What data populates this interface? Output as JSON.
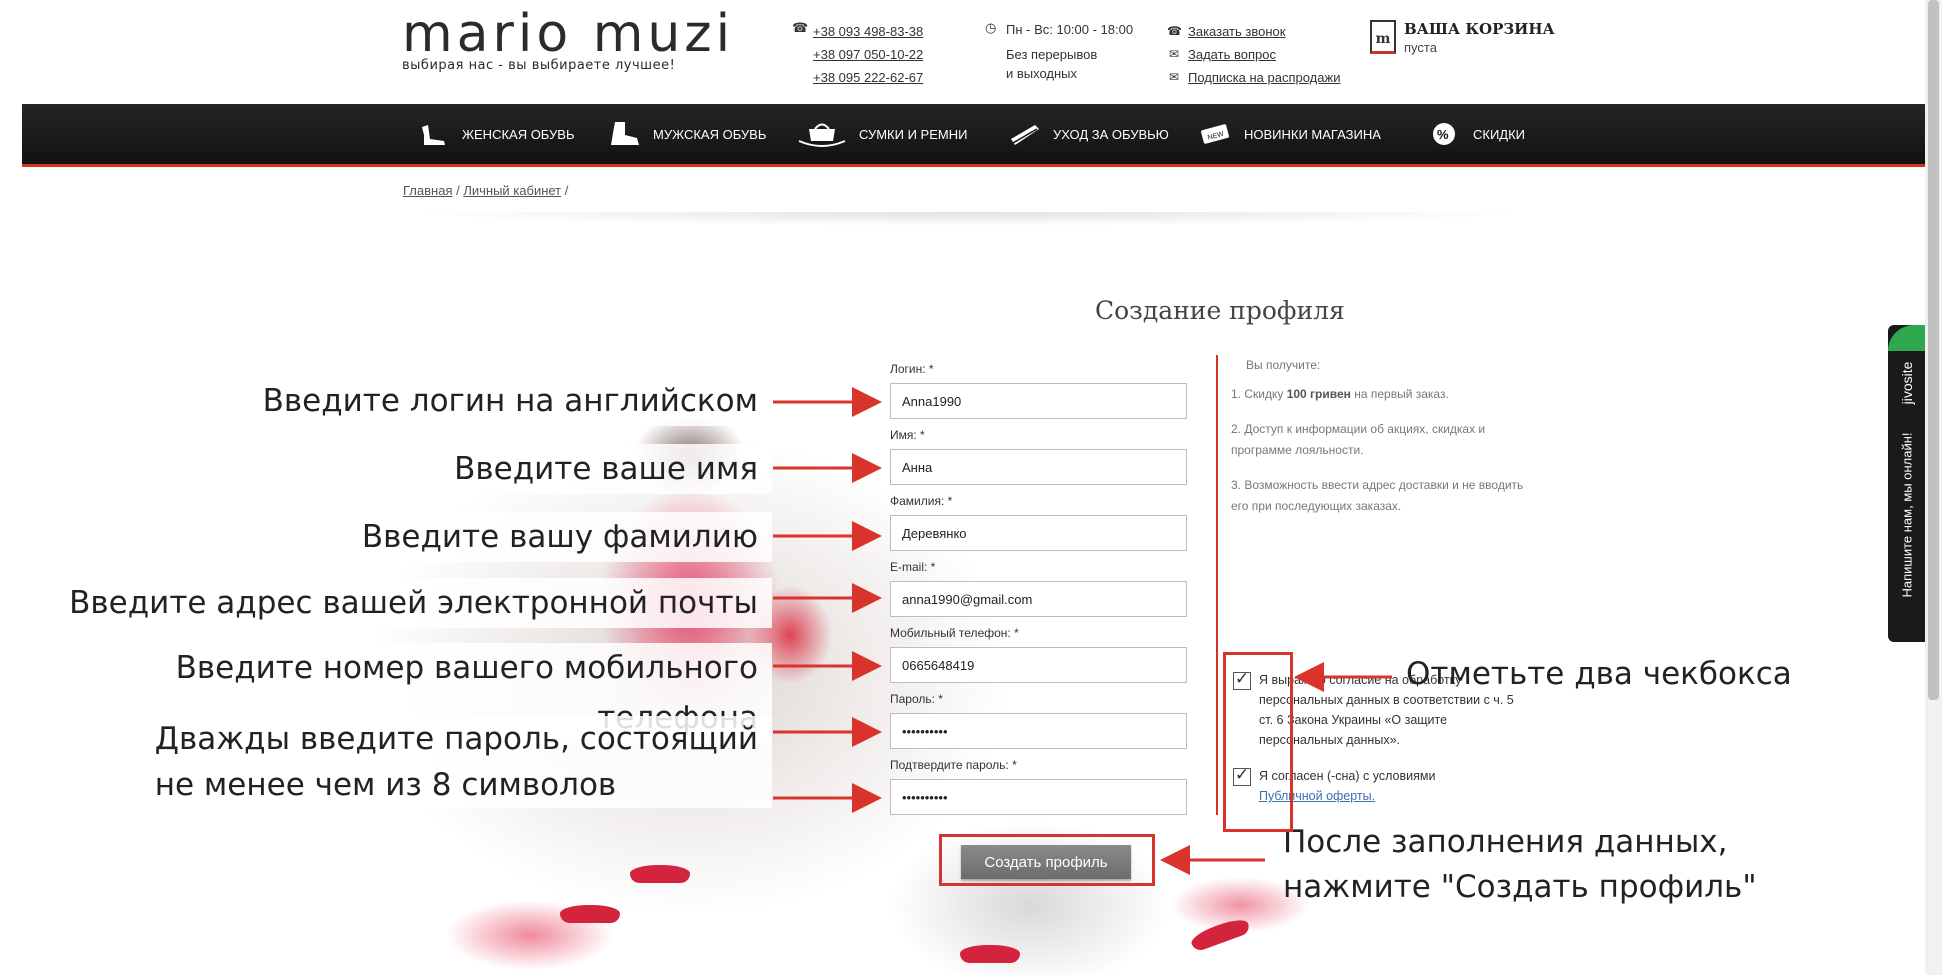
{
  "header": {
    "logo": "mario muzi",
    "tagline": "выбирая нас - вы выбираете лучшее!",
    "phones": [
      "+38 093 498-83-38",
      "+38 097 050-10-22",
      "+38 095 222-62-67"
    ],
    "hours_line1": "Пн - Вс: 10:00 - 18:00",
    "hours_line2": "Без перерывов",
    "hours_line3": "и выходных",
    "links": {
      "callback": "Заказать звонок",
      "question": "Задать вопрос",
      "subscribe": "Подписка на распродажи"
    },
    "cart": {
      "title": "ВАША КОРЗИНА",
      "status": "пуста"
    }
  },
  "nav": [
    {
      "label": "ЖЕНСКАЯ ОБУВЬ",
      "icon": "womens-shoe-icon"
    },
    {
      "label": "МУЖСКАЯ ОБУВЬ",
      "icon": "mens-boot-icon"
    },
    {
      "label": "СУМКИ И РЕМНИ",
      "icon": "bag-belt-icon"
    },
    {
      "label": "УХОД ЗА ОБУВЬЮ",
      "icon": "shoe-care-icon"
    },
    {
      "label": "НОВИНКИ МАГАЗИНА",
      "icon": "new-tag-icon"
    },
    {
      "label": "СКИДКИ",
      "icon": "discount-icon"
    }
  ],
  "breadcrumb": {
    "home": "Главная",
    "sep1": " / ",
    "cabinet": "Личный кабинет",
    "sep2": " /"
  },
  "form": {
    "title": "Создание профиля",
    "fields": [
      {
        "label": "Логин: *",
        "value": "Anna1990"
      },
      {
        "label": "Имя: *",
        "value": "Анна"
      },
      {
        "label": "Фамилия: *",
        "value": "Деревянко"
      },
      {
        "label": "E-mail: *",
        "value": "anna1990@gmail.com"
      },
      {
        "label": "Мобильный телефон: *",
        "value": "0665648419"
      },
      {
        "label": "Пароль: *",
        "value": "••••••••••"
      },
      {
        "label": "Подтвердите пароль: *",
        "value": "••••••••••"
      }
    ],
    "submit": "Создать профиль"
  },
  "benefits": {
    "title": "Вы получите:",
    "item1_pre": "1. Скидку ",
    "item1_bold": "100 гривен",
    "item1_post": " на первый заказ.",
    "item2": "2. Доступ к информации об акциях, скидках и программе лояльности.",
    "item3": "3. Возможность ввести адрес доставки и не вводить его при последующих заказах."
  },
  "agreements": {
    "consent": "Я выражаю согласие на обработку персональных данных в соответствии с ч. 5 ст. 6 Закона Украины «О защите персональных данных».",
    "terms_text": "Я согласен (-сна) с условиями",
    "terms_link": "Публичной оферты."
  },
  "annotations": {
    "login": "Введите логин на английском",
    "name": "Введите ваше имя",
    "surname": "Введите вашу фамилию",
    "email": "Введите адрес вашей электронной почты",
    "phone": "Введите номер вашего мобильного телефона",
    "password1": "Дважды введите пароль, состоящий",
    "password2": "не менее чем из 8 символов",
    "checkboxes": "Отметьте два чекбокса",
    "submit1": "После заполнения данных,",
    "submit2": "нажмите \"Создать профиль\""
  },
  "chat_widget": {
    "brand": "jivosite",
    "text": "Напишите нам, мы онлайн!"
  },
  "colors": {
    "accent": "#d4331f",
    "annotation_red": "#d9342b",
    "nav_bg": "#1a1a1a",
    "chat_green": "#2ea94e"
  }
}
